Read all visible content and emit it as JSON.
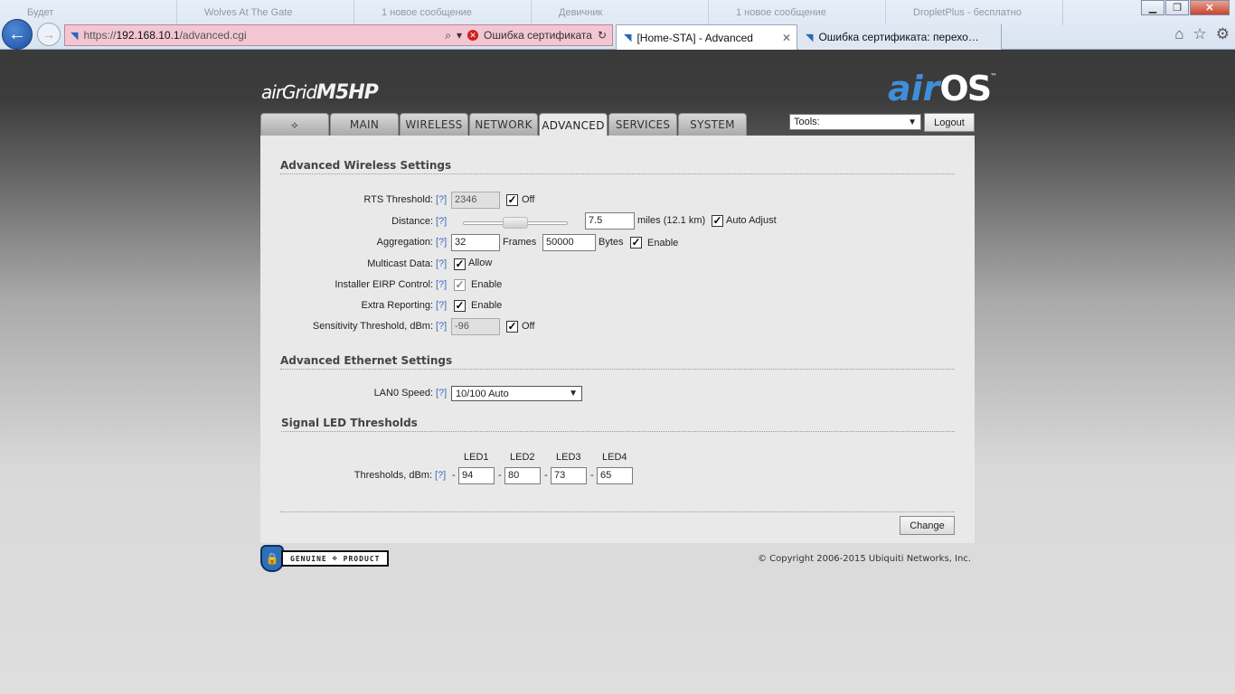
{
  "browser": {
    "background_tabs": [
      "Будет",
      "Wolves At The Gate",
      "1 новое сообщение",
      "Девичник",
      "1 новое сообщение",
      "DropletPlus - бесплатно"
    ],
    "url_prefix": "https://",
    "url_host": "192.168.10.1",
    "url_path": "/advanced.cgi",
    "cert_error": "Ошибка сертификата",
    "tab_active": "[Home-STA] - Advanced",
    "tab_other": "Ошибка сертификата: перехо…"
  },
  "brand": {
    "product_prefix": "airGrid",
    "product_model": "M5HP",
    "logo_air": "air",
    "logo_os": "OS",
    "logo_tm": "™"
  },
  "nav": {
    "tabs": [
      "MAIN",
      "WIRELESS",
      "NETWORK",
      "ADVANCED",
      "SERVICES",
      "SYSTEM"
    ],
    "active": "ADVANCED",
    "tools_label": "Tools:",
    "logout": "Logout"
  },
  "advanced_wireless": {
    "title": "Advanced Wireless Settings",
    "rts_label": "RTS Threshold:",
    "rts_value": "2346",
    "rts_off": "Off",
    "distance_label": "Distance:",
    "distance_value": "7.5",
    "distance_unit": "miles (12.1 km)",
    "auto_adjust": "Auto Adjust",
    "aggregation_label": "Aggregation:",
    "agg_frames": "32",
    "frames_label": "Frames",
    "agg_bytes": "50000",
    "bytes_label": "Bytes",
    "agg_enable": "Enable",
    "multicast_label": "Multicast Data:",
    "multicast_allow": "Allow",
    "eirp_label": "Installer EIRP Control:",
    "eirp_enable": "Enable",
    "extra_label": "Extra Reporting:",
    "extra_enable": "Enable",
    "sens_label": "Sensitivity Threshold, dBm:",
    "sens_value": "-96",
    "sens_off": "Off",
    "help": "[?]"
  },
  "advanced_ethernet": {
    "title": "Advanced Ethernet Settings",
    "lan_label": "LAN0 Speed:",
    "lan_value": "10/100 Auto"
  },
  "led": {
    "title": "Signal LED Thresholds",
    "headers": [
      "LED1",
      "LED2",
      "LED3",
      "LED4"
    ],
    "label": "Thresholds, dBm:",
    "values": [
      "94",
      "80",
      "73",
      "65"
    ],
    "dash": "-"
  },
  "footer": {
    "change": "Change",
    "genuine": "GENUINE",
    "product": "PRODUCT",
    "copyright": "© Copyright 2006-2015 Ubiquiti Networks, Inc."
  }
}
